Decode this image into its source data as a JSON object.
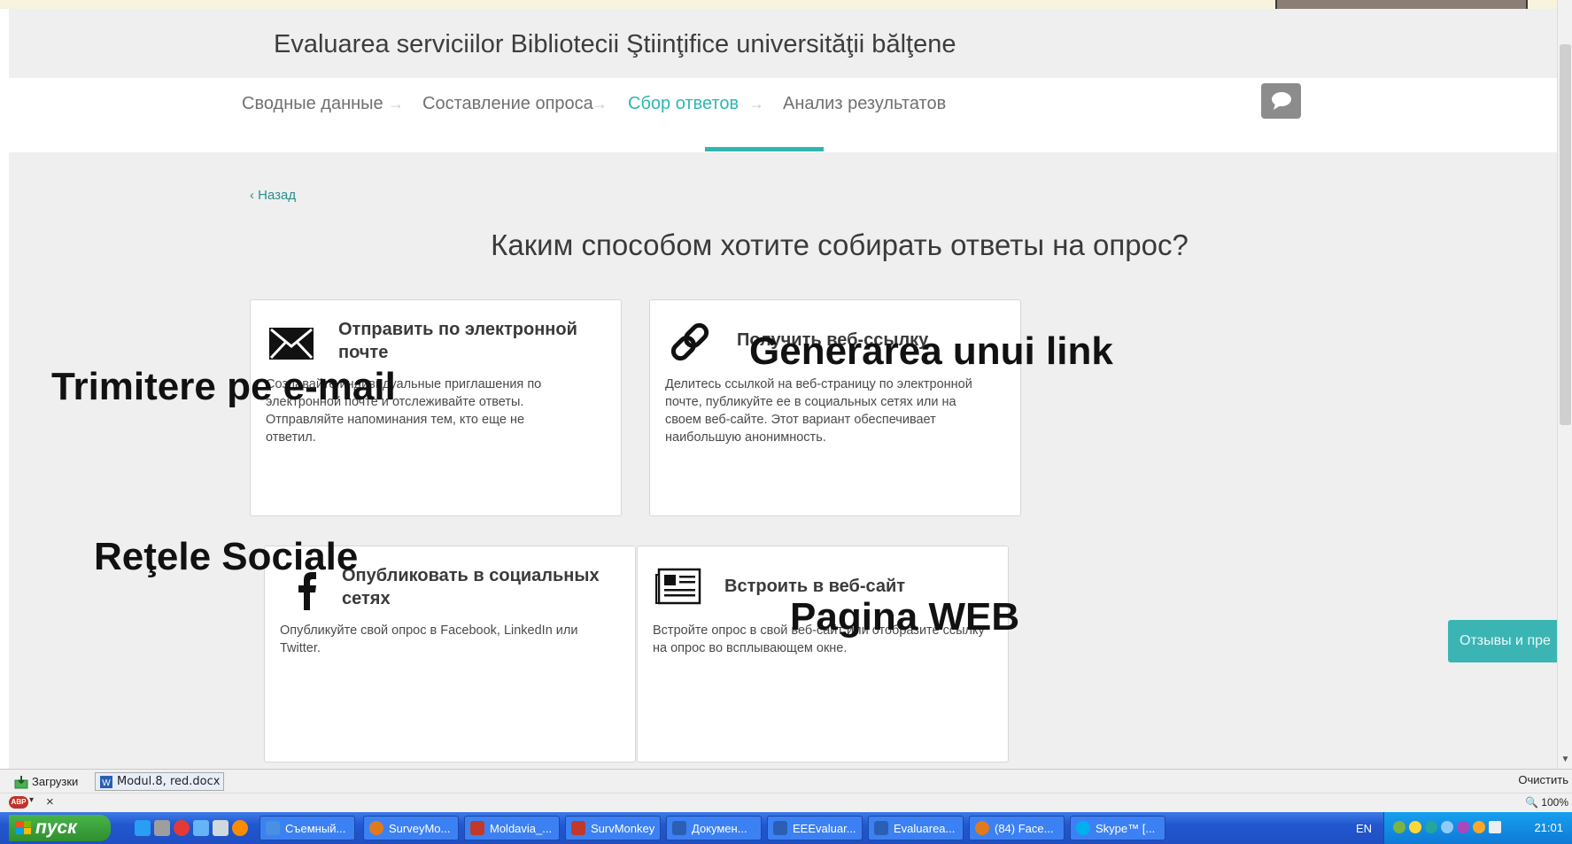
{
  "survey": {
    "title": "Evaluarea serviciilor Bibliotecii Ştiinţifice universităţii bălţene"
  },
  "nav": {
    "steps": [
      {
        "label": "Сводные данные",
        "active": false
      },
      {
        "label": "Составление опроса",
        "active": false
      },
      {
        "label": "Сбор ответов",
        "active": true
      },
      {
        "label": "Анализ результатов",
        "active": false
      }
    ],
    "arrow": "→",
    "accent_color": "#2fb6b0"
  },
  "content": {
    "back_label": "Назад",
    "back_chevron": "‹",
    "question": "Каким способом хотите собирать ответы на опрос?",
    "cards": [
      {
        "icon": "envelope-icon",
        "title": "Отправить по электронной почте",
        "description": "Создавайте индивидуальные приглашения по электронной почте и отслеживайте ответы. Отправляйте напоминания тем, кто еще не ответил."
      },
      {
        "icon": "link-icon",
        "title": "Получить веб-ссылку",
        "description": "Делитесь ссылкой на веб-страницу по электронной почте, публикуйте ее в социальных сетях или на своем веб-сайте. Этот вариант обеспечивает наибольшую анонимность."
      },
      {
        "icon": "facebook-icon",
        "title": "Опубликовать в социальных сетях",
        "description": "Опубликуйте свой опрос в Facebook, LinkedIn или Twitter."
      },
      {
        "icon": "newspaper-icon",
        "title": "Встроить в веб-сайт",
        "description": "Встройте опрос в свой веб-сайт или отобразите ссылку на опрос во всплывающем окне."
      }
    ]
  },
  "annotations": {
    "email": "Trimitere pe e-mail",
    "link": "Generarea unui link",
    "social": "Reţele Sociale",
    "web": "Pagina WEB"
  },
  "feedback_tab": "Отзывы и пре",
  "downloads": {
    "label": "Загрузки",
    "file": "Modul.8, red.docx",
    "clear": "Очистить"
  },
  "addon_bar": {
    "abp": "ABP",
    "close": "×",
    "zoom": "100%"
  },
  "taskbar": {
    "start": "пуск",
    "buttons": [
      {
        "label": "Съемный...",
        "icon_color": "#4a90e2"
      },
      {
        "label": "SurveyMo...",
        "icon_color": "#e07a1f"
      },
      {
        "label": "Moldavia_...",
        "icon_color": "#c0392b"
      },
      {
        "label": "SurvMonkey",
        "icon_color": "#c0392b"
      },
      {
        "label": "Докумен...",
        "icon_color": "#2b5fb4"
      },
      {
        "label": "EEEvaluar...",
        "icon_color": "#2b5fb4"
      },
      {
        "label": "Evaluarea...",
        "icon_color": "#2b5fb4"
      },
      {
        "label": "(84) Face...",
        "icon_color": "#e07a1f"
      },
      {
        "label": "Skype™ [...",
        "icon_color": "#00aff0"
      }
    ],
    "lang": "EN",
    "clock": "21:01"
  }
}
